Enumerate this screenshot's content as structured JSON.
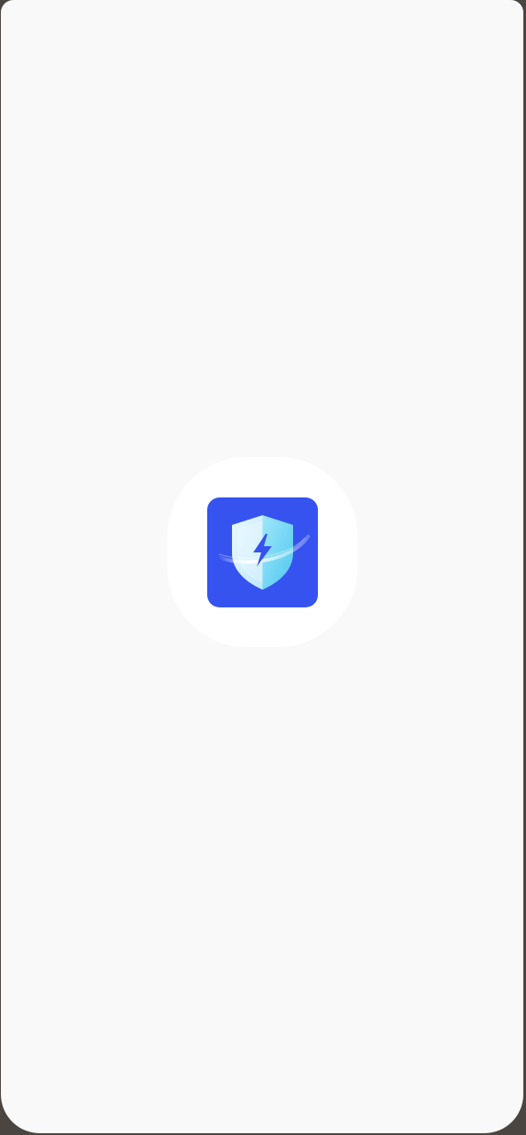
{
  "screen": {
    "type": "splash",
    "background_color": "#f9f9f9",
    "halo_color": "#ffffff"
  },
  "app_icon": {
    "icon": "shield-lightning-icon",
    "background_color": "#3653f0",
    "shield_light_color": "#cdeffd",
    "shield_accent_color": "#5fd3f2",
    "bolt_color": "#3653f0"
  }
}
